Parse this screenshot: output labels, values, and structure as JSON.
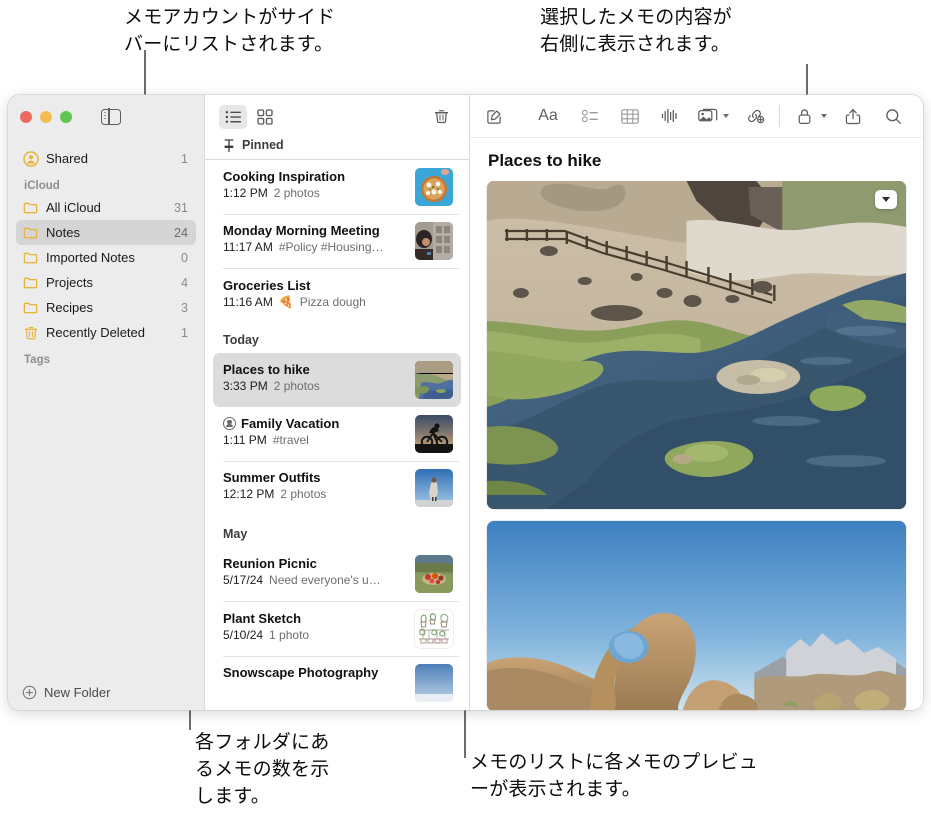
{
  "annotations": {
    "top_left": "メモアカウントがサイド\nバーにリストされます。",
    "top_right": "選択したメモの内容が\n右側に表示されます。",
    "bottom_left": "各フォルダにあ\nるメモの数を示\nします。",
    "bottom_right": "メモのリストに各メモのプレビュ\nーが表示されます。"
  },
  "window": {
    "traffic_lights": [
      "close",
      "minimize",
      "zoom"
    ],
    "sidebar_toggle_label": "sidebar-toggle"
  },
  "sidebar": {
    "top_items": [
      {
        "label": "Shared",
        "count": "1",
        "icon": "shared-icon",
        "selected": false
      }
    ],
    "sections": [
      {
        "title": "iCloud",
        "items": [
          {
            "label": "All iCloud",
            "count": "31",
            "icon": "folder-icon",
            "selected": false
          },
          {
            "label": "Notes",
            "count": "24",
            "icon": "folder-icon",
            "selected": true
          },
          {
            "label": "Imported Notes",
            "count": "0",
            "icon": "folder-icon",
            "selected": false
          },
          {
            "label": "Projects",
            "count": "4",
            "icon": "folder-icon",
            "selected": false
          },
          {
            "label": "Recipes",
            "count": "3",
            "icon": "folder-icon",
            "selected": false
          },
          {
            "label": "Recently Deleted",
            "count": "1",
            "icon": "trash-icon",
            "selected": false
          }
        ]
      },
      {
        "title": "Tags",
        "items": []
      }
    ],
    "new_folder_label": "New Folder"
  },
  "list_panel": {
    "toolbar": {
      "list_view": "list-view-icon",
      "gallery_view": "gallery-view-icon",
      "delete": "trash-icon"
    },
    "groups": [
      {
        "header": "Pinned",
        "pinned": true,
        "notes": [
          {
            "title": "Cooking Inspiration",
            "time": "1:12 PM",
            "preview": "2 photos",
            "thumb": "pizza",
            "shared": false,
            "selected": false,
            "emoji": ""
          },
          {
            "title": "Monday Morning Meeting",
            "time": "11:17 AM",
            "preview": "#Policy #Housing…",
            "thumb": "desk",
            "shared": false,
            "selected": false,
            "emoji": ""
          },
          {
            "title": "Groceries List",
            "time": "11:16 AM",
            "preview": "Pizza dough",
            "thumb": "",
            "shared": false,
            "selected": false,
            "emoji": "🍕"
          }
        ]
      },
      {
        "header": "Today",
        "pinned": false,
        "notes": [
          {
            "title": "Places to hike",
            "time": "3:33 PM",
            "preview": "2 photos",
            "thumb": "hike",
            "shared": false,
            "selected": true,
            "emoji": ""
          },
          {
            "title": "Family Vacation",
            "time": "1:11 PM",
            "preview": "#travel",
            "thumb": "bike",
            "shared": true,
            "selected": false,
            "emoji": ""
          },
          {
            "title": "Summer Outfits",
            "time": "12:12 PM",
            "preview": "2 photos",
            "thumb": "outfit",
            "shared": false,
            "selected": false,
            "emoji": ""
          }
        ]
      },
      {
        "header": "May",
        "pinned": false,
        "notes": [
          {
            "title": "Reunion Picnic",
            "time": "5/17/24",
            "preview": "Need everyone's u…",
            "thumb": "picnic",
            "shared": false,
            "selected": false,
            "emoji": ""
          },
          {
            "title": "Plant Sketch",
            "time": "5/10/24",
            "preview": "1 photo",
            "thumb": "plants",
            "shared": false,
            "selected": false,
            "emoji": ""
          },
          {
            "title": "Snowscape Photography",
            "time": "",
            "preview": "",
            "thumb": "snow",
            "shared": false,
            "selected": false,
            "emoji": ""
          }
        ]
      }
    ]
  },
  "editor": {
    "toolbar_icons": [
      "compose-icon",
      "format-icon",
      "checklist-icon",
      "table-icon",
      "audio-icon",
      "media-icon",
      "media-chevron-icon",
      "link-add-icon",
      "lock-icon",
      "lock-chevron-icon",
      "share-icon",
      "search-icon"
    ],
    "format_label": "Aa",
    "note_title": "Places to hike",
    "photos": [
      {
        "name": "hot-springs-river-photo",
        "menu": "photo-options-chevron-icon"
      },
      {
        "name": "mobius-arch-photo",
        "menu": ""
      }
    ]
  },
  "colors": {
    "folder_yellow": "#e8b33c",
    "selection_gray": "#d5d5d5",
    "sidebar_bg": "#ececec",
    "accent_text": "#1d1d1d"
  }
}
